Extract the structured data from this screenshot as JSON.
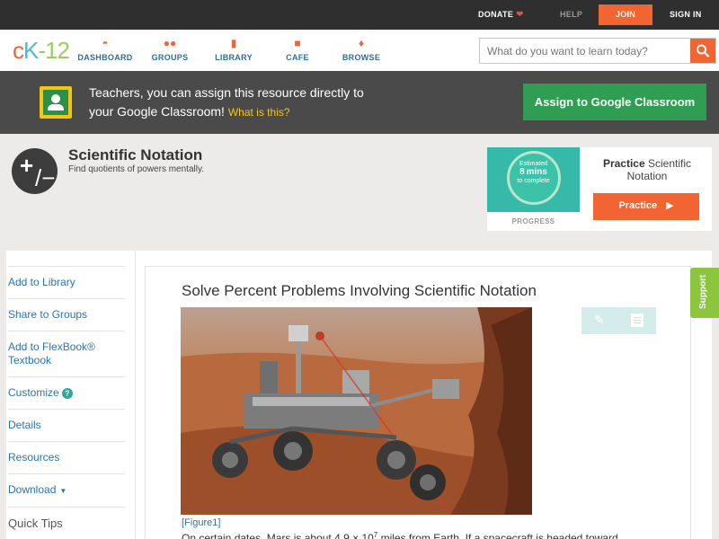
{
  "topbar": {
    "donate": "DONATE",
    "help": "HELP",
    "join": "JOIN",
    "signin": "SIGN IN"
  },
  "header": {
    "logo": {
      "part1": "c",
      "part2": "K",
      "part3": "-12"
    },
    "nav": [
      {
        "label": "DASHBOARD",
        "icon": "dashboard-icon"
      },
      {
        "label": "GROUPS",
        "icon": "groups-icon"
      },
      {
        "label": "LIBRARY",
        "icon": "library-icon"
      },
      {
        "label": "CAFE",
        "icon": "cafe-icon"
      },
      {
        "label": "BROWSE",
        "icon": "browse-icon"
      }
    ],
    "search_placeholder": "What do you want to learn today?"
  },
  "teacher_banner": {
    "text_line1": "Teachers, you can assign this resource directly to",
    "text_line2": "your Google Classroom!",
    "link": "What is this?",
    "button": "Assign to Google Classroom"
  },
  "concept": {
    "title": "Scientific Notation",
    "subtitle": "Find quotients of powers mentally."
  },
  "practice": {
    "estimated": "Estimated",
    "mins_value": "8",
    "mins_unit": "mins",
    "to_complete": "to complete",
    "progress_label": "PROGRESS",
    "title_bold": "Practice",
    "title_rest": "Scientific Notation",
    "button": "Practice"
  },
  "sidebar": {
    "items": [
      "Add to Library",
      "Share to Groups",
      "Add to FlexBook® Textbook",
      "Customize",
      "Details",
      "Resources",
      "Download",
      "Quick Tips"
    ]
  },
  "article": {
    "title": "Solve Percent Problems Involving Scientific Notation",
    "figure_caption": "[Figure1]",
    "body_start": "On certain dates, Mars is about 4.9 × 10",
    "body_exp": "7",
    "body_end": " miles from Earth. If a spacecraft is headed toward"
  },
  "support": "Support",
  "colors": {
    "accent": "#f26432",
    "link": "#2b73b0",
    "classroom_green": "#2f9e52",
    "support_green": "#8cc63f"
  }
}
